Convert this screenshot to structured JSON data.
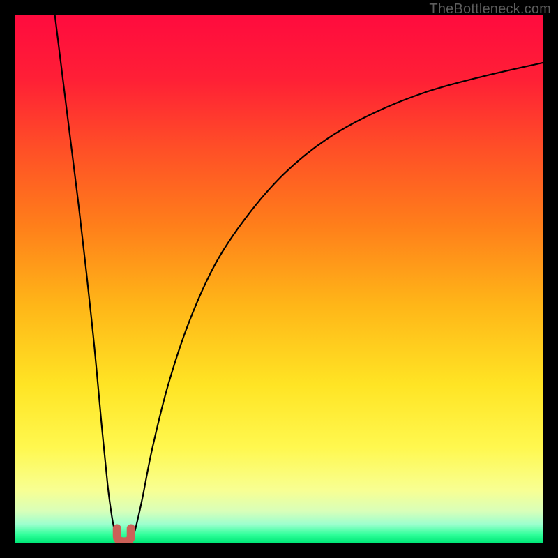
{
  "watermark": "TheBottleneck.com",
  "chart_data": {
    "type": "line",
    "title": "",
    "xlabel": "",
    "ylabel": "",
    "xlim": [
      0,
      100
    ],
    "ylim": [
      0,
      100
    ],
    "gradient_stops": [
      {
        "offset": 0.0,
        "color": "#ff0b3e"
      },
      {
        "offset": 0.12,
        "color": "#ff1f36"
      },
      {
        "offset": 0.25,
        "color": "#ff4e27"
      },
      {
        "offset": 0.4,
        "color": "#ff7f1a"
      },
      {
        "offset": 0.55,
        "color": "#ffb618"
      },
      {
        "offset": 0.7,
        "color": "#ffe424"
      },
      {
        "offset": 0.82,
        "color": "#fff84f"
      },
      {
        "offset": 0.9,
        "color": "#f8ff92"
      },
      {
        "offset": 0.94,
        "color": "#d9ffb9"
      },
      {
        "offset": 0.965,
        "color": "#9cffce"
      },
      {
        "offset": 0.985,
        "color": "#2fff9a"
      },
      {
        "offset": 1.0,
        "color": "#00e877"
      }
    ],
    "series": [
      {
        "name": "bottleneck-left-branch",
        "x": [
          7.5,
          9,
          10.5,
          12,
          13.5,
          15,
          16.3,
          17.5,
          18.3,
          19.0,
          19.5
        ],
        "y": [
          100,
          88,
          76,
          64,
          51,
          37,
          23,
          11,
          5,
          1.5,
          0.3
        ]
      },
      {
        "name": "bottleneck-right-branch",
        "x": [
          21.8,
          22.6,
          24,
          26,
          29,
          33,
          38,
          44,
          51,
          59,
          68,
          78,
          89,
          100
        ],
        "y": [
          0.3,
          2,
          8,
          18,
          30,
          42,
          53,
          62,
          70,
          76.5,
          81.5,
          85.5,
          88.5,
          91
        ]
      }
    ],
    "marker": {
      "name": "u-marker",
      "cx": 20.6,
      "cy": 1.0,
      "color": "#cb6058"
    }
  }
}
